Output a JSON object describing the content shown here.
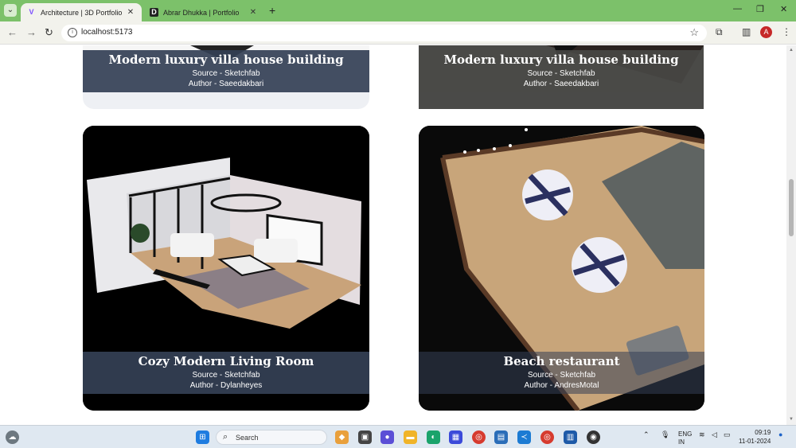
{
  "browser": {
    "tabs": [
      {
        "title": "Architecture | 3D Portfolio",
        "favicon": "V"
      },
      {
        "title": "Abrar Dhukka | Portfolio",
        "favicon": "D"
      }
    ],
    "new_tab": "+",
    "url": "localhost:5173",
    "profile_initial": "A",
    "window_controls": {
      "minimize": "—",
      "maximize": "❐",
      "close": "✕"
    }
  },
  "cards": [
    {
      "title": "Modern luxury villa house building",
      "source": "Source - Sketchfab",
      "author": "Author - Saeedakbari"
    },
    {
      "title": "Modern luxury villa house building",
      "source": "Source - Sketchfab",
      "author": "Author - Saeedakbari"
    },
    {
      "title": "Cozy Modern Living Room",
      "source": "Source - Sketchfab",
      "author": "Author - Dylanheyes"
    },
    {
      "title": "Beach restaurant",
      "source": "Source - Sketchfab",
      "author": "Author - AndresMotal"
    }
  ],
  "taskbar": {
    "search_placeholder": "Search",
    "lang_top": "ENG",
    "lang_bottom": "IN",
    "time": "09:19",
    "date": "11-01-2024"
  },
  "colors": {
    "titlebar": "#7cc16a",
    "caption_bg": "#344055"
  }
}
